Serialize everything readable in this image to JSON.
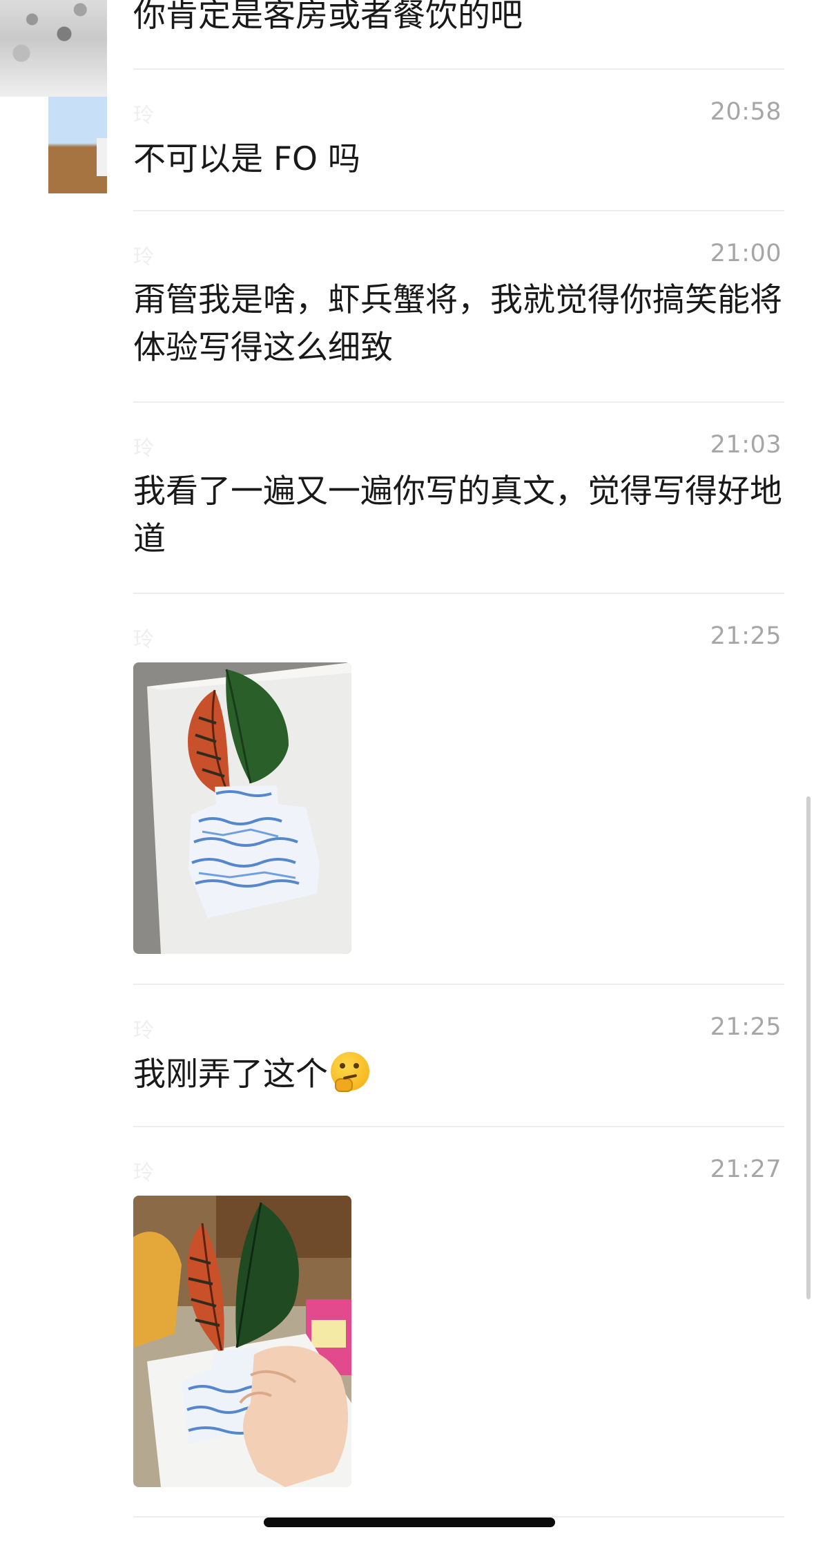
{
  "messages": [
    {
      "sender": "玲",
      "time": "",
      "text": "你肯定是客房或者餐饮的吧"
    },
    {
      "sender": "玲",
      "time": "20:58",
      "text": "不可以是 FO 吗"
    },
    {
      "sender": "玲",
      "time": "21:00",
      "text": "甭管我是啥，虾兵蟹将，我就觉得你搞笑能将体验写得这么细致"
    },
    {
      "sender": "玲",
      "time": "21:03",
      "text": "我看了一遍又一遍你写的真文，觉得写得好地道"
    },
    {
      "sender": "玲",
      "time": "21:25",
      "image": "leaf-vase-collage-photo"
    },
    {
      "sender": "玲",
      "time": "21:25",
      "text": "我刚弄了这个",
      "emoji": "thinking-face-emoji"
    },
    {
      "sender": "玲",
      "time": "21:27",
      "image": "leaf-vase-collage-in-hand-photo"
    }
  ],
  "colors": {
    "background": "#ffffff",
    "text": "#191919",
    "time": "#a6a6a6",
    "divider": "#ededed",
    "home_indicator": "#0b0b0b",
    "scrollbar": "#cfcfcf"
  },
  "icons": [
    "thinking-face-emoji"
  ]
}
